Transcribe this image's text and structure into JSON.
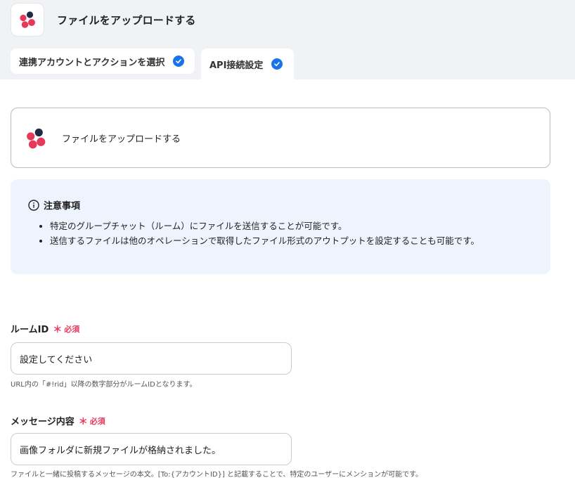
{
  "header": {
    "title": "ファイルをアップロードする",
    "icon": "app-logo-icon"
  },
  "tabs": [
    {
      "label": "連携アカウントとアクションを選択",
      "completed": true
    },
    {
      "label": "API接続設定",
      "completed": true,
      "active": true
    }
  ],
  "action_card": {
    "label": "ファイルをアップロードする",
    "icon": "app-logo-icon"
  },
  "notice": {
    "title": "注意事項",
    "icon": "info-icon",
    "items": [
      "特定のグループチャット（ルーム）にファイルを送信することが可能です。",
      "送信するファイルは他のオペレーションで取得したファイル形式のアウトプットを設定することも可能です。"
    ]
  },
  "fields": {
    "room_id": {
      "label": "ルームID",
      "required_mark": "＊",
      "required_text": "必須",
      "value": "設定してください",
      "hint": "URL内の「#!rid」以降の数字部分がルームIDとなります。"
    },
    "message": {
      "label": "メッセージ内容",
      "required_mark": "＊",
      "required_text": "必須",
      "value": "画像フォルダに新規ファイルが格納されました。",
      "hint": "ファイルと一緒に投稿するメッセージの本文。[To:{アカウントID}] と記載することで、特定のユーザーにメンションが可能です。"
    }
  },
  "colors": {
    "accent": "#1a73e8",
    "required": "#e8385a",
    "notice_bg": "#eef4fd",
    "header_bg": "#f0f2f5",
    "logo_red": "#e8385a",
    "logo_dark": "#1f2a44"
  }
}
